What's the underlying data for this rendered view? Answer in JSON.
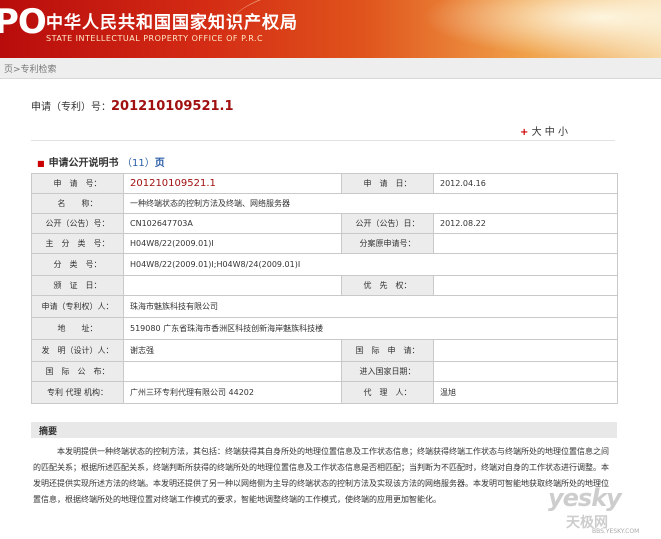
{
  "header": {
    "logo_text": "PO",
    "title_cn": "中华人民共和国国家知识产权局",
    "title_en": "STATE INTELLECTUAL PROPERTY OFFICE OF P.R.C"
  },
  "breadcrumb": "页>专利检索",
  "application": {
    "label": "申请（专利）号：",
    "number": "201210109521.1"
  },
  "font_controls": {
    "plus": "+",
    "large": "大",
    "medium": "中",
    "small": "小"
  },
  "section": {
    "title": "申请公开说明书",
    "count_prefix": "（",
    "count": "11",
    "count_suffix": "）",
    "page_word": "页"
  },
  "table": {
    "rows": [
      {
        "l1": "申　请　号：",
        "v1": "201210109521.1",
        "l2": "申　请　日：",
        "v2": "2012.04.16"
      },
      {
        "l1": "名　　称：",
        "v1": "一种终端状态的控制方法及终端、网络服务器"
      },
      {
        "l1": "公开（公告）号：",
        "v1": "CN102647703A",
        "l2": "公开（公告）日：",
        "v2": "2012.08.22"
      },
      {
        "l1": "主　分　类　号：",
        "v1": "H04W8/22(2009.01)I",
        "l2": "分案原申请号：",
        "v2": ""
      },
      {
        "l1": "分　类　号：",
        "v1": "H04W8/22(2009.01)I;H04W8/24(2009.01)I"
      },
      {
        "l1": "颁　证　日：",
        "v1": "",
        "l2": "优　先　权：",
        "v2": ""
      },
      {
        "l1": "申请（专利权）人：",
        "v1": "珠海市魅族科技有限公司"
      },
      {
        "l1": "地　　址：",
        "v1": "519080 广东省珠海市香洲区科技创新海岸魅族科技楼"
      },
      {
        "l1": "发　明（设计）人：",
        "v1": "谢志强",
        "l2": "国　际　申　请：",
        "v2": ""
      },
      {
        "l1": "国　际　公　布：",
        "v1": "",
        "l2": "进入国家日期：",
        "v2": ""
      },
      {
        "l1": "专利 代理 机构：",
        "v1": "广州三环专利代理有限公司 44202",
        "l2": "代　理　人：",
        "v2": "温旭"
      }
    ]
  },
  "abstract": {
    "title": "摘要",
    "text": "本发明提供一种终端状态的控制方法，其包括：终端获得其自身所处的地理位置信息及工作状态信息；终端获得终端工作状态与终端所处的地理位置信息之间的匹配关系；根据所述匹配关系，终端判断所获得的终端所处的地理位置信息及工作状态信息是否相匹配；当判断为不匹配时，终端对自身的工作状态进行调整。本发明还提供实现所述方法的终端。本发明还提供了另一种以网络侧为主导的终端状态的控制方法及实现该方法的网络服务器。本发明可智能地获取终端所处的地理位置信息，根据终端所处的地理位置对终端工作模式的要求，智能地调整终端的工作模式，使终端的应用更加智能化。"
  },
  "watermark": {
    "brand": "yesky",
    "brand_cn": "天极网",
    "url": "BBS.YESKY.COM"
  }
}
